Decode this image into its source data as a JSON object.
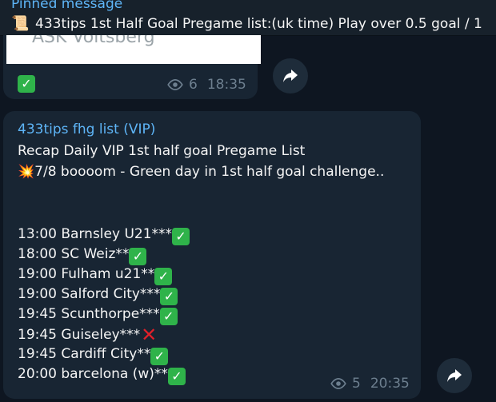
{
  "pinned": {
    "title": "Pinned message",
    "icon": "scroll-icon",
    "text": "433tips 1st Half Goal Pregame list:(uk time) Play over 0.5 goal / 1"
  },
  "message1": {
    "image_text": "ASK Voitsberg",
    "views": "6",
    "time": "18:35"
  },
  "message2": {
    "author": "433tips fhg list (VIP)",
    "subtitle": "Recap Daily VIP 1st half goal Pregame List",
    "headline": "7/8  boooom - Green day in 1st half goal challenge..",
    "headline_icon": "collision-icon",
    "tips": [
      {
        "text": "13:00 Barnsley U21***",
        "result": "win"
      },
      {
        "text": "18:00 SC Weiz**",
        "result": "win"
      },
      {
        "text": "19:00 Fulham u21**",
        "result": "win"
      },
      {
        "text": "19:00 Salford City***",
        "result": "win"
      },
      {
        "text": "19:45 Scunthorpe***",
        "result": "win"
      },
      {
        "text": "19:45 Guiseley***",
        "result": "loss"
      },
      {
        "text": "19:45 Cardiff City**",
        "result": "win"
      },
      {
        "text": "20:00 barcelona (w)**",
        "result": "win"
      }
    ],
    "views": "5",
    "time": "20:35"
  },
  "colors": {
    "background": "#0e1621",
    "bubble": "#182533",
    "accent": "#5eb5f7",
    "meta": "#6d7f8f",
    "check": "#2fb34a",
    "cross": "#e0202a"
  }
}
